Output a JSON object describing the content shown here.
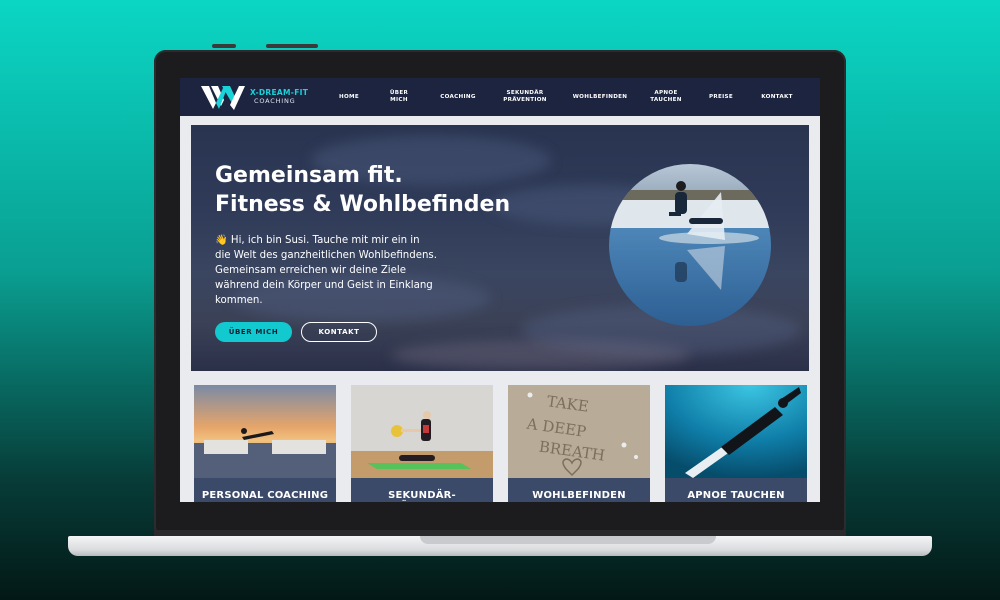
{
  "brand": {
    "name": "X-DREAM-FIT",
    "sub": "COACHING"
  },
  "nav": {
    "items": [
      {
        "lines": [
          "HOME"
        ]
      },
      {
        "lines": [
          "ÜBER",
          "MICH"
        ]
      },
      {
        "lines": [
          "COACHING"
        ]
      },
      {
        "lines": [
          "SEKUNDÄR",
          "PRÄVENTION"
        ]
      },
      {
        "lines": [
          "WOHLBEFINDEN"
        ]
      },
      {
        "lines": [
          "APNOE",
          "TAUCHEN"
        ]
      },
      {
        "lines": [
          "PREISE"
        ]
      },
      {
        "lines": [
          "KONTAKT"
        ]
      }
    ]
  },
  "hero": {
    "title_line1": "Gemeinsam fit.",
    "title_line2": "Fitness & Wohlbefinden",
    "text_lines": [
      "👋 Hi, ich bin Susi. Tauche mit mir ein in",
      "die Welt des ganzheitlichen Wohlbefindens.",
      "Gemeinsam erreichen wir deine Ziele",
      "während dein Körper und Geist in Einklang",
      "kommen."
    ],
    "btn_primary": "ÜBER MICH",
    "btn_secondary": "KONTAKT"
  },
  "cards": [
    {
      "label": "PERSONAL COACHING"
    },
    {
      "label": "SEKUNDÄR-PRÄVENTION"
    },
    {
      "label": "WOHLBEFINDEN"
    },
    {
      "label": "APNOE TAUCHEN"
    }
  ],
  "sand_text": [
    "TAKE",
    "A DEEP",
    "BREATH"
  ],
  "colors": {
    "accent": "#13c9d0",
    "nav_bg": "#1d2440",
    "card_label_bg": "#3c4a69"
  }
}
